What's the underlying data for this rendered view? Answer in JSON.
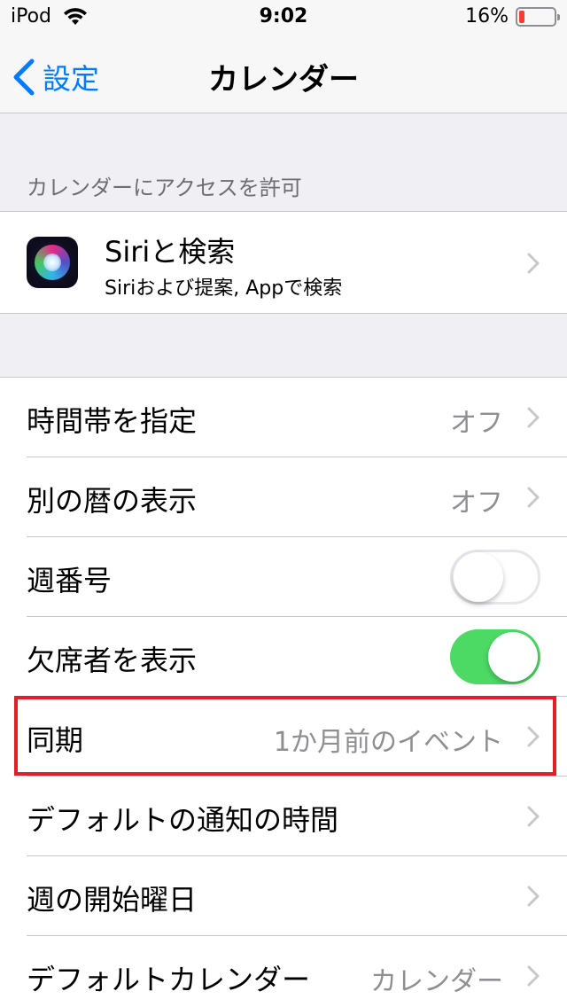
{
  "status_bar": {
    "carrier": "iPod",
    "time": "9:02",
    "battery": "16%",
    "battery_level": 0.16,
    "battery_color": "#ff3b30"
  },
  "nav": {
    "back_label": "設定",
    "title": "カレンダー"
  },
  "access_section": {
    "header": "カレンダーにアクセスを許可",
    "siri": {
      "title": "Siriと検索",
      "subtitle": "Siriおよび提案, Appで検索",
      "icon": "siri-icon"
    }
  },
  "settings": {
    "time_zone": {
      "label": "時間帯を指定",
      "value": "オフ"
    },
    "alt_calendar": {
      "label": "別の暦の表示",
      "value": "オフ"
    },
    "week_numbers": {
      "label": "週番号",
      "state": "off"
    },
    "show_declined": {
      "label": "欠席者を表示",
      "state": "on"
    },
    "sync": {
      "label": "同期",
      "value": "1か月前のイベント"
    },
    "default_alert": {
      "label": "デフォルトの通知の時間"
    },
    "week_start": {
      "label": "週の開始曜日"
    },
    "default_calendar": {
      "label": "デフォルトカレンダー",
      "value": "カレンダー"
    }
  },
  "colors": {
    "accent": "#007aff",
    "toggle_on": "#4cd964",
    "highlight": "#e11f2b",
    "background": "#efeff4"
  }
}
